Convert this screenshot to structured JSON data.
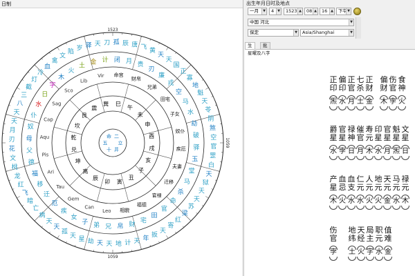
{
  "left_panel": {
    "title": "日制"
  },
  "wheel": {
    "degree_labels": {
      "top": "1523",
      "bottom": "1059",
      "right": "1059"
    },
    "colors": {
      "stars": "#2ea0c6",
      "houses": "#1d7fc4",
      "text": "#111111",
      "water": "#d9191c",
      "wood": "#c21db8",
      "fire": "#7aa317",
      "gold": "#a48a12"
    },
    "outer_ring": [
      "孤",
      "辰",
      "唐",
      "飞",
      "黄",
      "天",
      "天",
      "国",
      "正",
      "寡",
      "地",
      "魁",
      "天",
      "苓",
      "阴",
      "煞",
      "空",
      "官",
      "罡",
      "白",
      "天",
      "狱",
      "天",
      "天",
      "苏",
      "梁",
      "红",
      "寄",
      "天",
      "扳",
      "年",
      "天",
      "计",
      "地",
      "天",
      "天",
      "劫",
      "星",
      "天",
      "孤",
      "天",
      "天",
      "病",
      "亡",
      "暗",
      "飞",
      "红",
      "龙",
      "桃",
      "文",
      "花",
      "刃",
      "月",
      "天",
      "天",
      "八",
      "三",
      "截",
      "灯",
      "冷",
      "血",
      "禽",
      "文",
      "陷",
      "岁",
      "驿",
      "天",
      "刀"
    ],
    "middle_ring": [
      "闭",
      "月",
      "贵",
      "刃",
      "廉",
      "戎",
      "空",
      "马",
      "水",
      "劫",
      "破",
      "驿",
      "玉",
      "堂",
      "马",
      "杀",
      "命",
      "官",
      "田",
      "宅",
      "财",
      "帛",
      "兄",
      "弟",
      "子",
      "女",
      "疾",
      "厄",
      "迁",
      "移",
      "福",
      "德",
      "父",
      "母",
      "奴",
      "仆",
      "水",
      "日",
      "字",
      "木",
      "火",
      "土",
      "金",
      "计"
    ],
    "inner_ring": [
      "命宫",
      "财帛",
      "兄弟",
      "田宅",
      "子女",
      "奴仆",
      "疾厄",
      "夫妻",
      "迁移",
      "官禄",
      "福德",
      "相貌",
      "Leo",
      "Can",
      "Gem",
      "Tau",
      "Ari",
      "Pis",
      "Aqu",
      "Cap",
      "Sag",
      "Sco",
      "Lib",
      "Vir"
    ],
    "core_ring": [
      "巳",
      "午",
      "未",
      "申",
      "酉",
      "戌",
      "亥",
      "子",
      "丑",
      "寅",
      "卯",
      "辰",
      "离",
      "坤",
      "兑",
      "乾",
      "坎",
      "艮",
      "震",
      "巽"
    ],
    "center": [
      "二",
      "立",
      "井",
      "十",
      "五",
      "命"
    ]
  },
  "right_panel": {
    "title": "出生年月日时及地点",
    "fields": {
      "month": "一月",
      "day": "4",
      "year": "1523",
      "hour": "08",
      "minute": "16",
      "ampm": "下午",
      "country": "中国 河北",
      "city": "保定",
      "timezone": "Asia/Shanghai"
    },
    "tabs": [
      "生年",
      "批注"
    ],
    "heading": "星曜及八字",
    "block1": {
      "columns": [
        "正印",
        "偏印",
        "正官",
        "七杀",
        "正财",
        "偏财",
        "伤官",
        "食神"
      ],
      "values": [
        "炁",
        "水",
        "月",
        "土",
        "金",
        "木",
        "孛",
        "火"
      ]
    },
    "block2": {
      "columns": [
        "爵星",
        "官星",
        "禄神",
        "催官",
        "寿元",
        "印星",
        "官星",
        "魁星",
        "文星"
      ],
      "values": [
        "水",
        "孛",
        "日",
        "月",
        "木",
        "水",
        "月",
        "炁",
        "日"
      ]
    },
    "block3": {
      "columns": [
        "产星",
        "血忌",
        "血支",
        "仁元",
        "人元",
        "地元",
        "天元",
        "马元",
        "禄元"
      ],
      "values": [
        "木",
        "火",
        "水",
        "水",
        "火",
        "火",
        "金",
        "水",
        "木"
      ]
    },
    "block4": {
      "columns": [
        "伤官",
        "地纬",
        "天经",
        "局主",
        "职元",
        "值难"
      ],
      "values": [
        "孛",
        "土",
        "火",
        "字",
        "水",
        "金"
      ]
    }
  }
}
